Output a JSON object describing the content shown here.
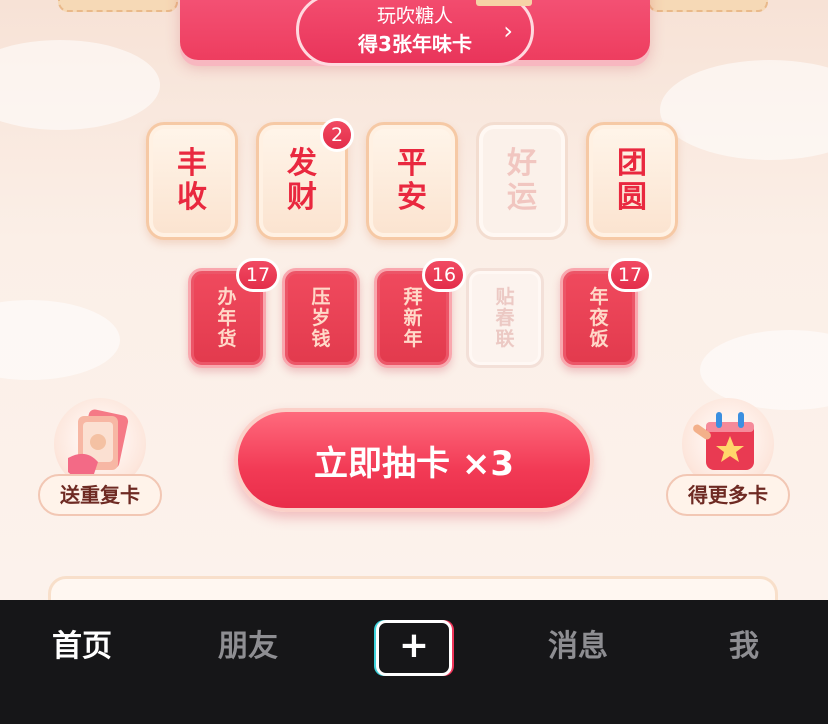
{
  "banner": {
    "line1": "玩吹糖人",
    "line2": "得3张年味卡",
    "chevron": "›"
  },
  "big_cards": [
    {
      "chars": [
        "丰",
        "收"
      ],
      "badge": null,
      "collected": true
    },
    {
      "chars": [
        "发",
        "财"
      ],
      "badge": "2",
      "collected": true
    },
    {
      "chars": [
        "平",
        "安"
      ],
      "badge": null,
      "collected": true
    },
    {
      "chars": [
        "好",
        "运"
      ],
      "badge": null,
      "collected": false
    },
    {
      "chars": [
        "团",
        "圆"
      ],
      "badge": null,
      "collected": true
    }
  ],
  "small_cards": [
    {
      "chars": [
        "办",
        "年",
        "货"
      ],
      "badge": "17",
      "collected": true
    },
    {
      "chars": [
        "压",
        "岁",
        "钱"
      ],
      "badge": null,
      "collected": true
    },
    {
      "chars": [
        "拜",
        "新",
        "年"
      ],
      "badge": "16",
      "collected": true
    },
    {
      "chars": [
        "贴",
        "春",
        "联"
      ],
      "badge": null,
      "collected": false
    },
    {
      "chars": [
        "年",
        "夜",
        "饭"
      ],
      "badge": "17",
      "collected": true
    }
  ],
  "actions": {
    "draw_label": "立即抽卡 ×3",
    "gift_label": "送重复卡",
    "more_label": "得更多卡"
  },
  "tabbar": {
    "home": "首页",
    "friends": "朋友",
    "plus": "+",
    "messages": "消息",
    "me": "我"
  },
  "colors": {
    "accent": "#f23a55",
    "tabbar_bg": "#161618",
    "card_text": "#e9283f"
  }
}
